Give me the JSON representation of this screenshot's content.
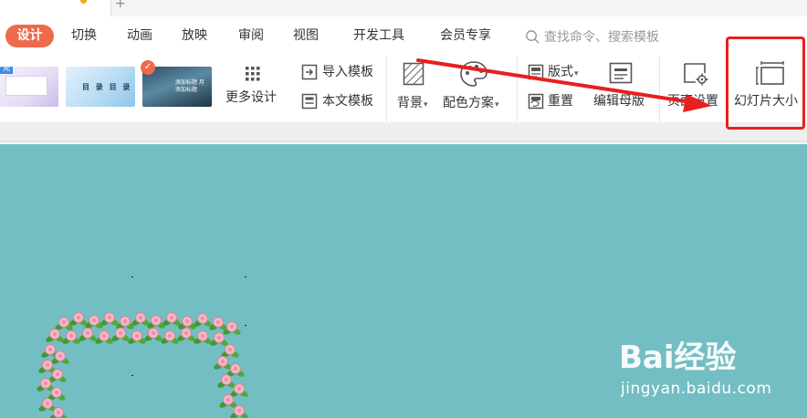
{
  "menu": {
    "active": "设计",
    "items": [
      "切换",
      "动画",
      "放映",
      "审阅",
      "视图",
      "开发工具",
      "会员专享"
    ],
    "search_placeholder": "查找命令、搜索模板"
  },
  "ribbon": {
    "thumb1_badge": "免",
    "thumb2_caption": "目 录 目 录",
    "thumb3_caption": "添加标题 月 添加标题",
    "more_designs": "更多设计",
    "import_template": "导入模板",
    "text_template": "本文模板",
    "background": "背景",
    "color_scheme": "配色方案",
    "layout": "版式",
    "reset": "重置",
    "edit_master": "编辑母版",
    "page_setup": "页面设置",
    "slide_size": "幻灯片大小"
  },
  "watermark": {
    "brand": "Bai经验",
    "url": "jingyan.baidu.com"
  },
  "colors": {
    "accent": "#ef6a4b",
    "annotation": "#e81f1f",
    "slide_background": "#73bec3"
  },
  "icons": [
    "grid-icon",
    "import-icon",
    "text-template-icon",
    "background-icon",
    "palette-icon",
    "layout-icon",
    "reset-icon",
    "edit-master-icon",
    "page-setup-icon",
    "slide-size-icon",
    "search-icon"
  ]
}
